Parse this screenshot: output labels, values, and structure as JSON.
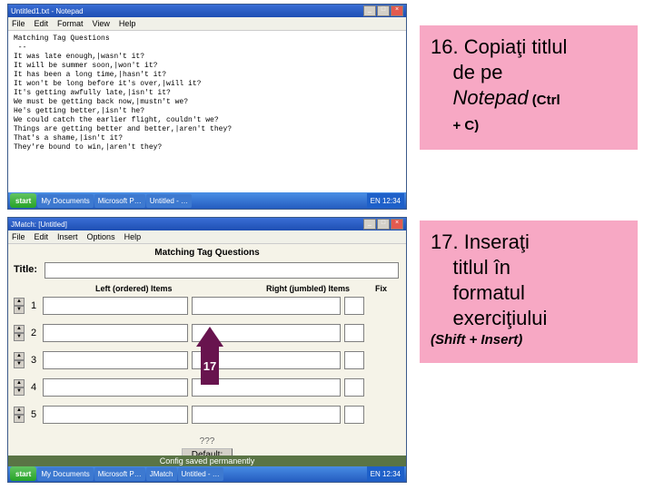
{
  "instructions": {
    "step16_num": "16.",
    "step16_line1": "Copiaţi titlul",
    "step16_line2": "de pe",
    "step16_line3a": "Notepad",
    "step16_line3b": " (Ctrl",
    "step16_line4": "+ C)",
    "step17_num": "17.",
    "step17_line1": "Inseraţi",
    "step17_line2": "titlul în",
    "step17_line3": "formatul",
    "step17_line4": "exerciţiului",
    "step17_sub": "(Shift + Insert)"
  },
  "notepad": {
    "title": "Untitled1.txt - Notepad",
    "menus": [
      "File",
      "Edit",
      "Format",
      "View",
      "Help"
    ],
    "content": "Matching Tag Questions\n --\nIt was late enough,|wasn't it?\nIt will be summer soon,|won't it?\nIt has been a long time,|hasn't it?\nIt won't be long before it's over,|will it?\nIt's getting awfully late,|isn't it?\nWe must be getting back now,|mustn't we?\nHe's getting better,|isn't he?\nWe could catch the earlier flight, couldn't we?\nThings are getting better and better,|aren't they?\nThat's a shame,|isn't it?\nThey're bound to win,|aren't they?"
  },
  "jmatch": {
    "title": "JMatch: [Untitled]",
    "menus": [
      "File",
      "Edit",
      "Insert",
      "Options",
      "Help"
    ],
    "heading": "Matching Tag Questions",
    "title_label": "Title:",
    "left_col": "Left (ordered) Items",
    "right_col": "Right (jumbled) Items",
    "fix_col": "Fix",
    "rows": [
      "1",
      "2",
      "3",
      "4",
      "5"
    ],
    "qmark": "???",
    "default_btn": "Default:",
    "config": "Config saved permanently"
  },
  "taskbar": {
    "start": "start",
    "items_top": [
      "My Documents",
      "Microsoft P…",
      "Untitled - …"
    ],
    "items_bot": [
      "My Documents",
      "Microsoft P…",
      "JMatch",
      "Untitled - …"
    ],
    "tray": "EN 12:34"
  },
  "arrow": {
    "label": "17"
  }
}
